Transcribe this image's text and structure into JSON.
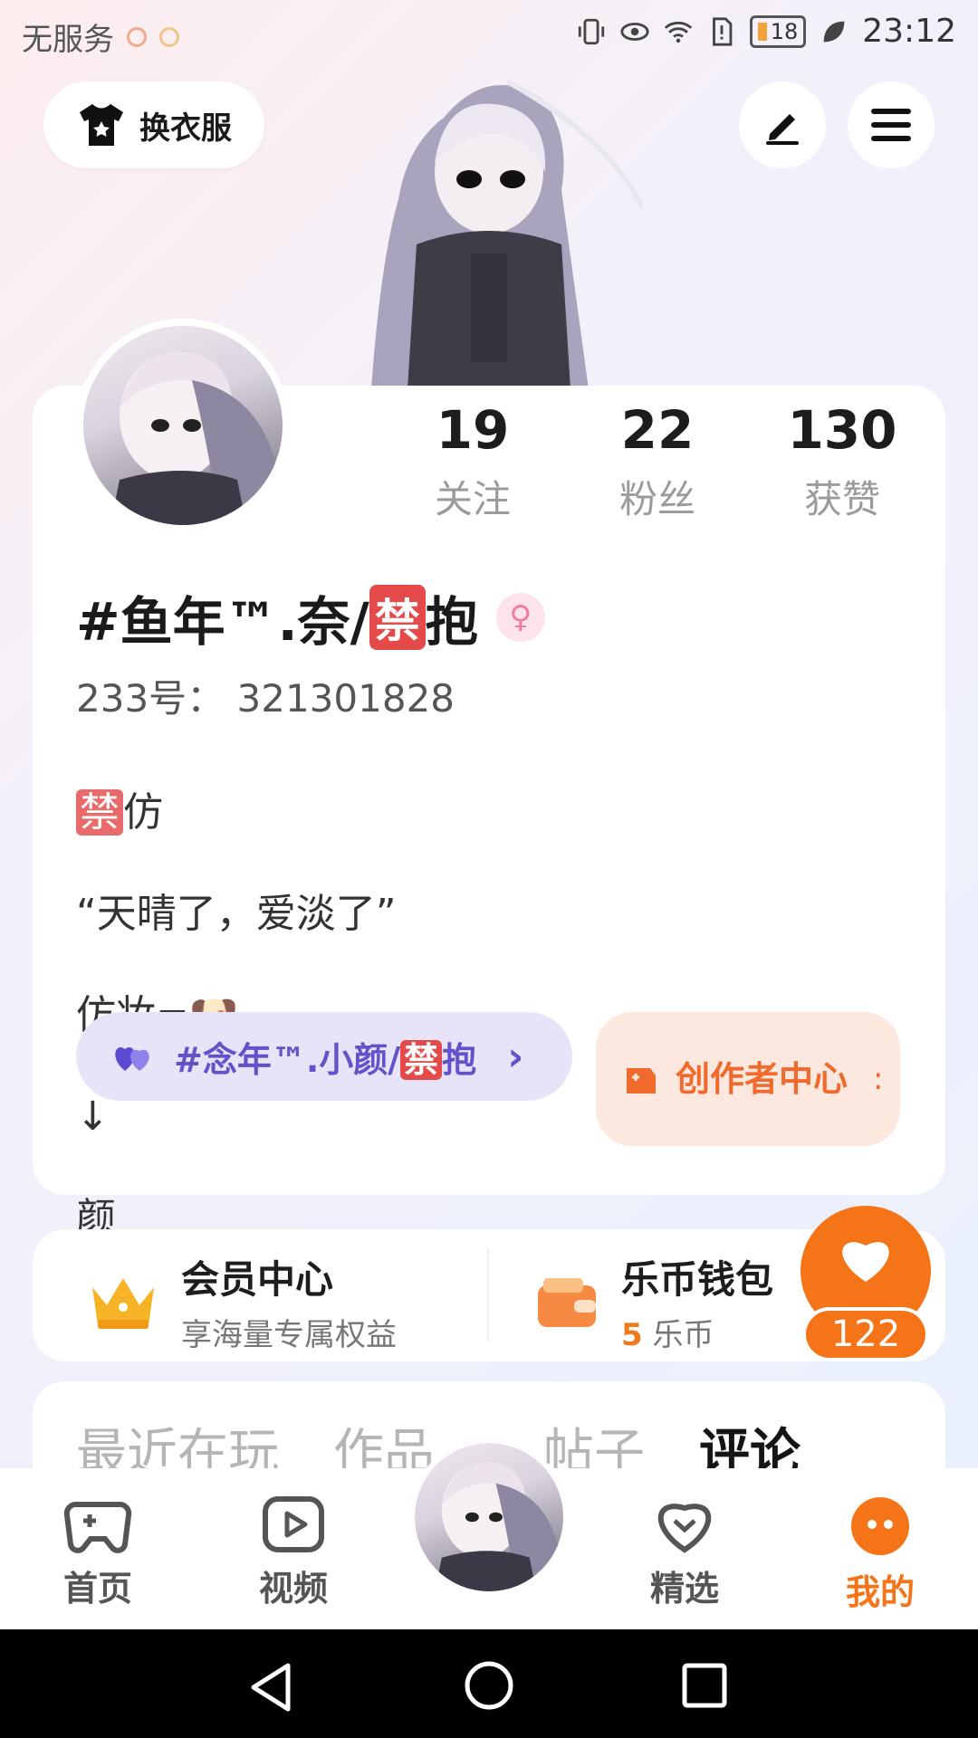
{
  "status_bar": {
    "carrier": "无服务",
    "battery": "18",
    "time": "23:12"
  },
  "top_bar": {
    "outfit_label": "换衣服",
    "edit_icon": "pen-icon",
    "menu_icon": "hamburger-icon"
  },
  "profile": {
    "stats": [
      {
        "num": "19",
        "label": "关注"
      },
      {
        "num": "22",
        "label": "粉丝"
      },
      {
        "num": "130",
        "label": "获赞"
      }
    ],
    "username_prefix": "#鱼年™.奈/",
    "username_badge": "禁",
    "username_suffix": "抱",
    "gender_symbol": "♀",
    "uid": "233号： 321301828",
    "bio_line1_badge": "禁",
    "bio_line1": "仿",
    "bio_line2": "“天晴了，爱淡了”",
    "bio_line3": "仿妆=🐶",
    "bio_line4": "↓",
    "bio_line5": "颜",
    "group_prefix": "#念年™.小颜/",
    "group_badge": "禁",
    "group_suffix": "抱",
    "group_chevron": "›",
    "creator_label": "创作者中心",
    "creator_trail": ":"
  },
  "member": {
    "title": "会员中心",
    "subtitle": "享海量专属权益"
  },
  "wallet": {
    "title": "乐币钱包",
    "amount": "5",
    "unit": " 乐币"
  },
  "like_fab": {
    "count": "122"
  },
  "tabs": [
    {
      "label": "最近在玩"
    },
    {
      "label": "作品"
    },
    {
      "label": "帖子"
    },
    {
      "label": "评论"
    }
  ],
  "bottom_nav": [
    {
      "label": "首页"
    },
    {
      "label": "视频"
    },
    {
      "label": "精选"
    },
    {
      "label": "我的"
    }
  ],
  "colors": {
    "accent": "#f57418",
    "group_purple": "#6352c9"
  }
}
